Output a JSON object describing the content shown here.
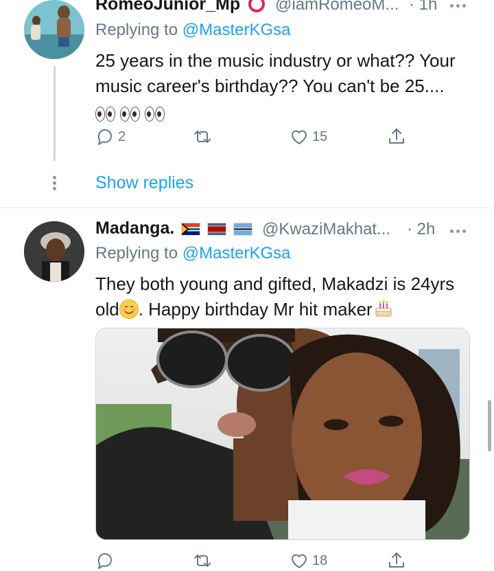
{
  "tweet1": {
    "name": "RomeoJunior_Mp",
    "handle": "@iamRomeoM...",
    "time": "· 1h",
    "replying_prefix": "Replying to ",
    "replying_to": "@MasterKGsa",
    "text_line1": "25 years in the music industry or what?? Your",
    "text_line2": "music career's birthday?? You can't be 25....",
    "emoji": "eyes-emoji",
    "reply_count": "2",
    "retweet_count": "",
    "like_count": "15"
  },
  "show_replies_label": "Show replies",
  "tweet2": {
    "name": "Madanga.",
    "flags": [
      "south-africa-flag",
      "eswatini-flag",
      "botswana-flag"
    ],
    "handle": "@KwaziMakhat...",
    "time": "· 2h",
    "replying_prefix": "Replying to ",
    "replying_to": "@MasterKGsa",
    "text_line1": "They both young and gifted, Makadzi is 24yrs",
    "text_line2a": "old",
    "text_line2b": ". Happy birthday Mr hit maker",
    "reply_count": "",
    "retweet_count": "",
    "like_count": "18"
  },
  "colors": {
    "link": "#1da1f2",
    "secondary": "#657786",
    "primary_text": "#14171a",
    "divider": "#e6ecf0"
  }
}
